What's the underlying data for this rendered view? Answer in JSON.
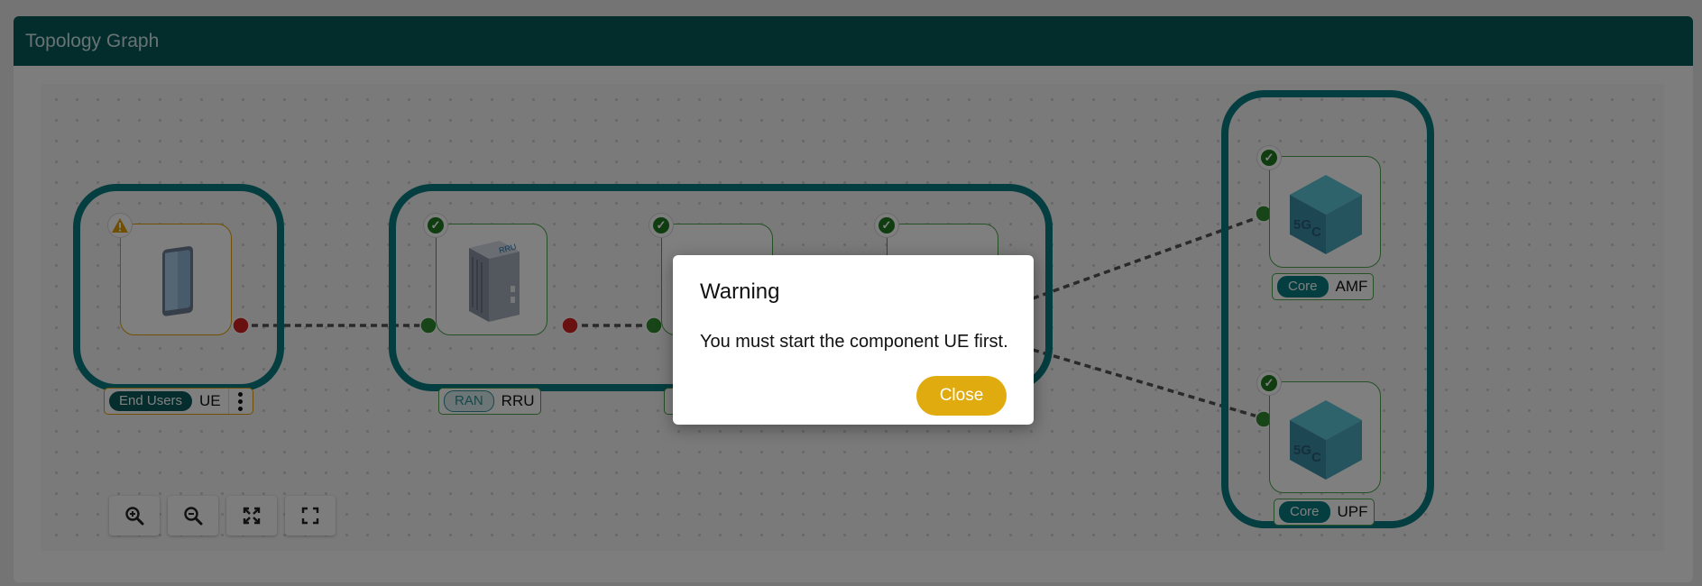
{
  "panel": {
    "title": "Topology Graph"
  },
  "groups": [
    {
      "name": "end-users-group",
      "nodes": [
        {
          "name": "UE",
          "category": "End Users",
          "status": "warning",
          "device_icon": "phone-icon"
        }
      ]
    },
    {
      "name": "ran-group",
      "nodes": [
        {
          "name": "RRU",
          "category": "RAN",
          "status": "ok",
          "device_icon": "rru-device-icon"
        },
        {
          "name": "",
          "category": "",
          "status": "ok",
          "device_icon": "ran-node-icon"
        },
        {
          "name": "",
          "category": "",
          "status": "ok",
          "device_icon": "ran-node-icon"
        }
      ]
    },
    {
      "name": "core-group",
      "nodes": [
        {
          "name": "AMF",
          "category": "Core",
          "status": "ok",
          "device_icon": "5gc-cube-icon"
        },
        {
          "name": "UPF",
          "category": "Core",
          "status": "ok",
          "device_icon": "5gc-cube-icon"
        }
      ]
    }
  ],
  "controls": [
    {
      "name": "zoom-in",
      "icon": "zoom-in-icon"
    },
    {
      "name": "zoom-out",
      "icon": "zoom-out-icon"
    },
    {
      "name": "fit-view",
      "icon": "fit-view-icon"
    },
    {
      "name": "fullscreen",
      "icon": "fullscreen-icon"
    }
  ],
  "dialog": {
    "title": "Warning",
    "message": "You must start the component UE first.",
    "close_label": "Close"
  },
  "colors": {
    "header": "#06585a",
    "group_border": "#0a7d80",
    "ok": "#1f7a1f",
    "warning": "#e0a100",
    "error_port": "#d32020",
    "button": "#e0ab0f"
  }
}
